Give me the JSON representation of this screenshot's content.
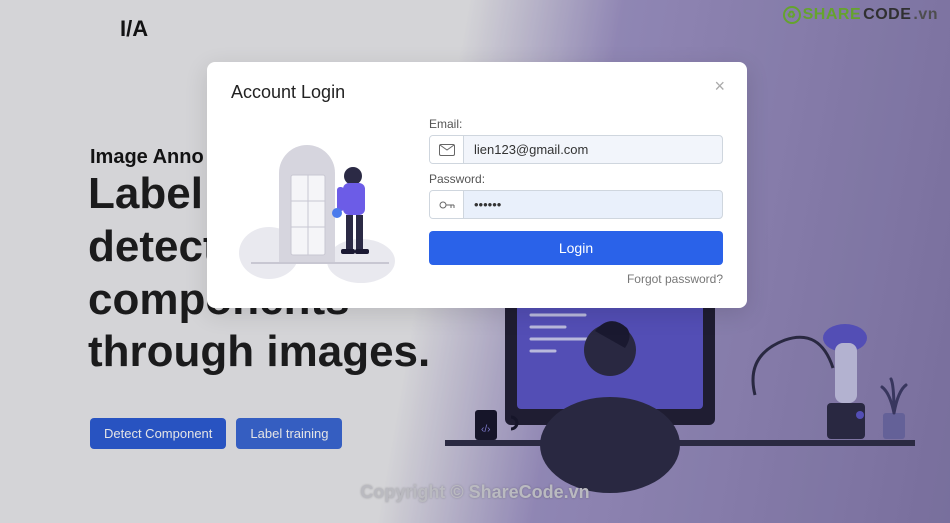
{
  "brand": "I/A",
  "watermark_brand": {
    "share": "SHARE",
    "code": "CODE",
    "tail": ".vn"
  },
  "hero": {
    "subtitle": "Image Anno",
    "title_line1": "Label",
    "title_line2": "detect",
    "title_line3": "components",
    "title_line4": "through images."
  },
  "buttons": {
    "detect": "Detect Component",
    "label": "Label training"
  },
  "modal": {
    "title": "Account Login",
    "email_label": "Email:",
    "password_label": "Password:",
    "email_value": "lien123@gmail.com",
    "password_value": "••••••",
    "login": "Login",
    "forgot": "Forgot password?"
  },
  "watermark_center": "ShareCode.vn",
  "copyright": "Copyright © ShareCode.vn"
}
